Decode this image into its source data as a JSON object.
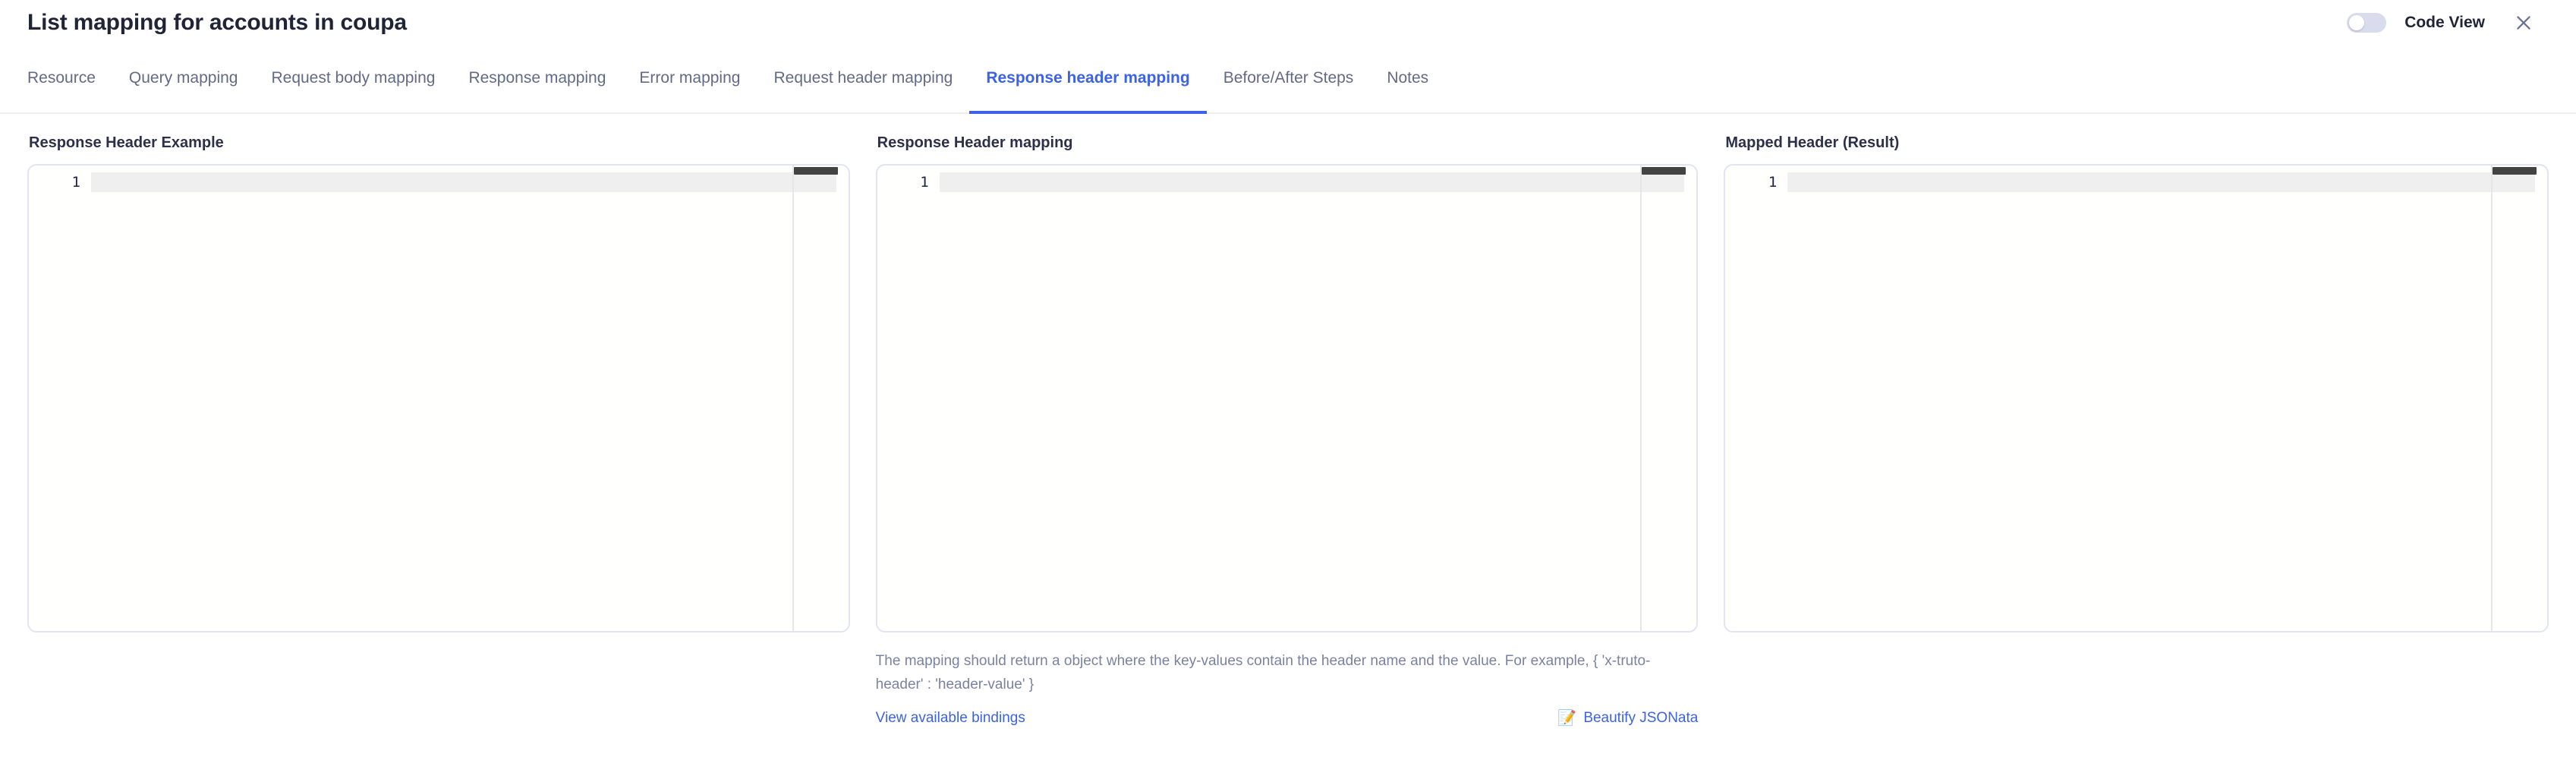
{
  "header": {
    "title": "List mapping for accounts in coupa",
    "code_view_label": "Code View",
    "code_view_enabled": false,
    "close_icon": "close-icon",
    "toggle_track_color": "#d9dced",
    "accent_color": "#3c62e8"
  },
  "tabs": [
    {
      "label": "Resource",
      "active": false
    },
    {
      "label": "Query mapping",
      "active": false
    },
    {
      "label": "Request body mapping",
      "active": false
    },
    {
      "label": "Response mapping",
      "active": false
    },
    {
      "label": "Error mapping",
      "active": false
    },
    {
      "label": "Request header mapping",
      "active": false
    },
    {
      "label": "Response header mapping",
      "active": true
    },
    {
      "label": "Before/After Steps",
      "active": false
    },
    {
      "label": "Notes",
      "active": false
    }
  ],
  "panels": {
    "left": {
      "heading": "Response Header Example",
      "line_number": "1",
      "content": ""
    },
    "middle": {
      "heading": "Response Header mapping",
      "line_number": "1",
      "content": "",
      "helper_text": "The mapping should return a object where the key-values contain the header name and the value. For example, { 'x-truto-header' : 'header-value' }",
      "bindings_link": "View available bindings",
      "beautify_icon": "memo-icon",
      "beautify_glyph": "📝",
      "beautify_link": "Beautify JSONata"
    },
    "right": {
      "heading": "Mapped Header (Result)",
      "line_number": "1",
      "content": ""
    }
  }
}
